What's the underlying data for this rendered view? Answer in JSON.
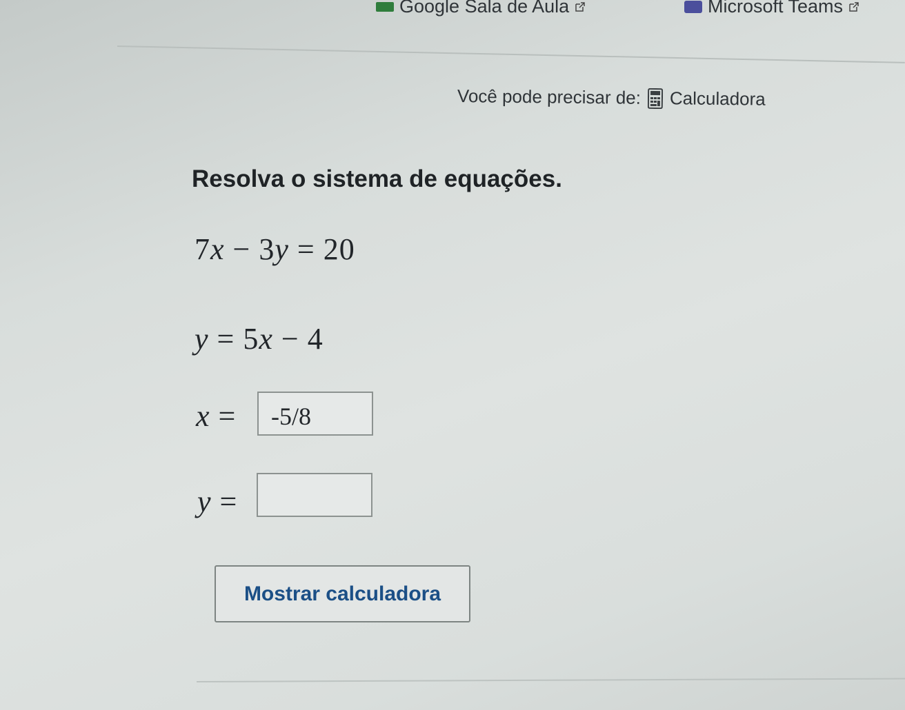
{
  "top_links": {
    "google_classroom": "Google Sala de Aula",
    "teams": "Microsoft Teams"
  },
  "hint": {
    "prefix": "Você pode precisar de:",
    "calculator": "Calculadora"
  },
  "problem": {
    "prompt": "Resolva o sistema de equações.",
    "eq1": {
      "a": "7",
      "v1": "x",
      "op": "−",
      "b": "3",
      "v2": "y",
      "eq": "=",
      "rhs": "20"
    },
    "eq2": {
      "lhs": "y",
      "eq": "=",
      "a": "5",
      "v": "x",
      "op": "−",
      "b": "4"
    }
  },
  "answers": {
    "x_label": "x",
    "y_label": "y",
    "eq": "=",
    "x_value": "-5/8",
    "y_value": ""
  },
  "button": {
    "label": "Mostrar calculadora"
  },
  "colors": {
    "button_text": "#1b4f86",
    "background": "#dfe3e1"
  }
}
